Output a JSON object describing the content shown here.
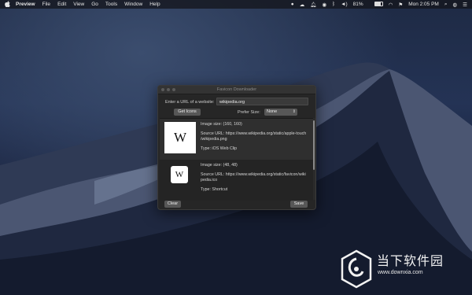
{
  "menubar": {
    "apple": "",
    "items": [
      "Preview",
      "File",
      "Edit",
      "View",
      "Go",
      "Tools",
      "Window",
      "Help"
    ],
    "status": {
      "battery": "81%",
      "battery_level": 0.81,
      "clock": "Mon 2:05 PM"
    }
  },
  "window": {
    "title": "Favicon Downloader",
    "url_label": "Enter a URL of a website:",
    "url_value": "wikipedia.org",
    "get_icons": "Get Icons",
    "prefer_label": "Prefer Size:",
    "prefer_value": "None",
    "items": [
      {
        "size": "Image size: (160, 160)",
        "source1": "Source URL: https://www.wikipedia.org/static/apple-touch",
        "source2": "/wikipedia.png",
        "type": "Type: iOS Web Clip",
        "glyph": "W"
      },
      {
        "size": "Image size: (48, 48)",
        "source1": "Source URL: https://www.wikipedia.org/static/favicon/wiki",
        "source2": "pedia.ico",
        "type": "Type: Shortcut",
        "glyph": "W"
      }
    ],
    "clear": "Clear",
    "save": "Save"
  },
  "watermark": {
    "cn": "当下软件园",
    "url": "www.downxia.com"
  },
  "colors": {
    "window_bg": "#262626",
    "button_bg": "#575757",
    "desktop": "#1e2a44"
  }
}
